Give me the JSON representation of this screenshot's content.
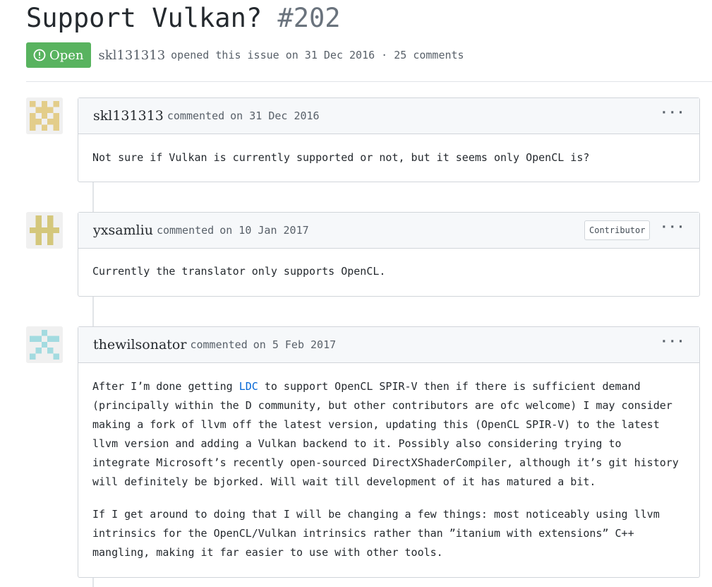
{
  "issue": {
    "title": "Support Vulkan?",
    "number": "#202",
    "state": "Open",
    "author": "skl131313",
    "meta": "opened this issue on 31 Dec 2016 · 25 comments"
  },
  "comments": [
    {
      "author": "skl131313",
      "action": "commented",
      "date": "on 31 Dec 2016",
      "badge": "",
      "body": "Not sure if Vulkan is currently supported or not, but it seems only OpenCL is?"
    },
    {
      "author": "yxsamliu",
      "action": "commented",
      "date": "on 10 Jan 2017",
      "badge": "Contributor",
      "body": "Currently the translator only supports OpenCL."
    },
    {
      "author": "thewilsonator",
      "action": "commented",
      "date": "on 5 Feb 2017",
      "badge": "",
      "p1_before": "After I’m done getting ",
      "p1_link": "LDC",
      "p1_line1_after": " to support OpenCL SPIR-V then if there is sufficient demand",
      "p1_line2": "(principally within the D community, but other contributors are ofc welcome) I may consider",
      "p1_line3": "making a fork of llvm off the latest version, updating this (OpenCL SPIR-V) to the latest",
      "p1_line4": "llvm version and adding a Vulkan backend to it. Possibly also considering trying to",
      "p1_line5": "integrate Microsoft’s recently open-sourced DirectXShaderCompiler, although it’s git history",
      "p1_line6": "will definitely be bjorked. Will wait till development of it has matured a bit.",
      "p2_line1": "If I get around to doing that I will be changing a few things: most noticeably using llvm",
      "p2_line2": "intrinsics for the OpenCL/Vulkan intrinsics rather than ”itanium with extensions” C++",
      "p2_line3": "mangling, making it far easier to use with other tools."
    }
  ],
  "icons": {
    "state": "issue-opened-icon",
    "menu": "kebab-horizontal-icon"
  },
  "colors": {
    "open_green": "#58b35f",
    "link_blue": "#0366d6"
  },
  "menu_glyph": "···"
}
